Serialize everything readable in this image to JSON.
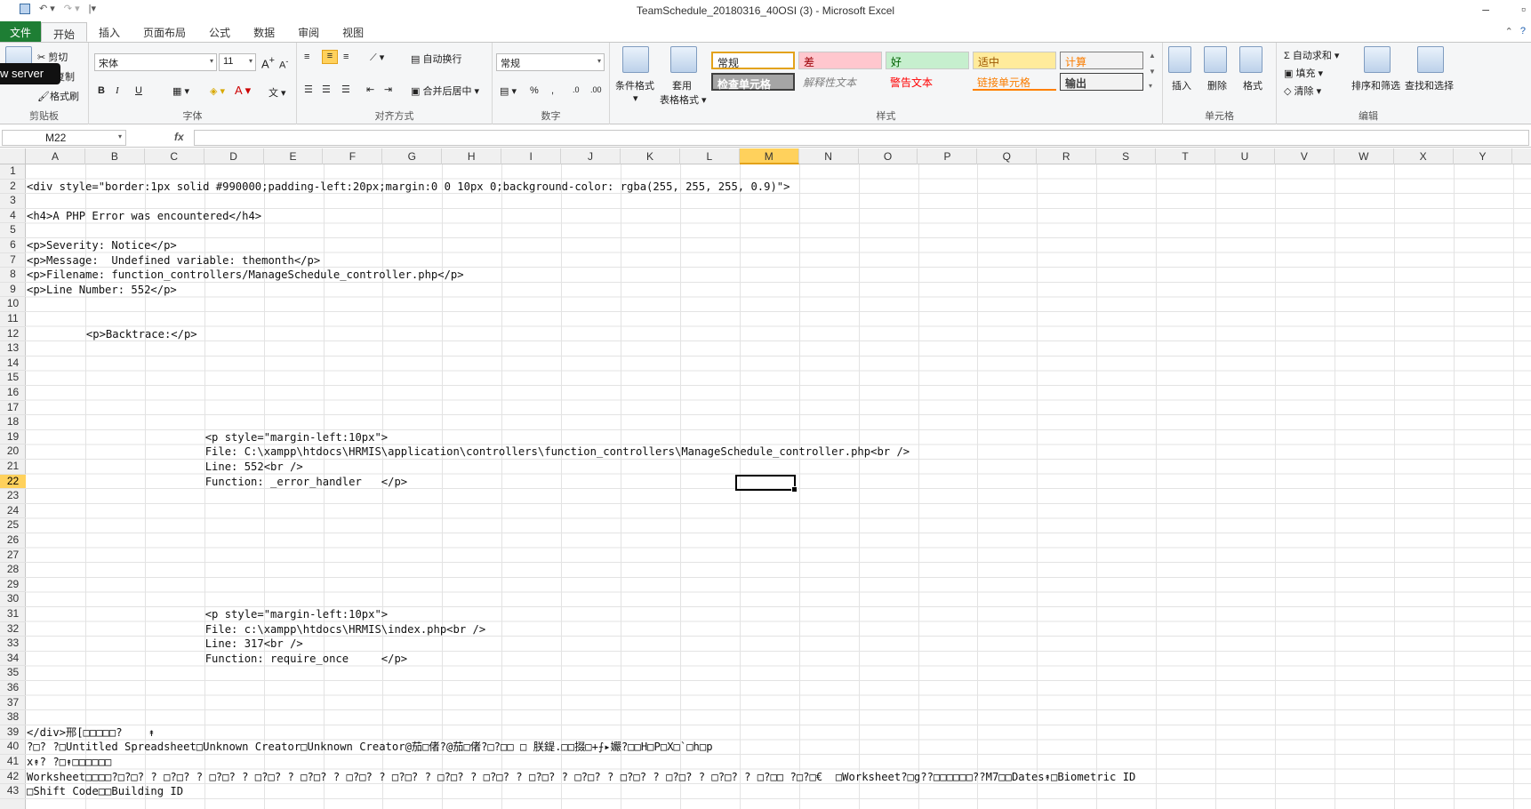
{
  "window": {
    "title": "TeamSchedule_20180316_40OSI (3)  -  Microsoft Excel"
  },
  "tabs": [
    "文件",
    "开始",
    "插入",
    "页面布局",
    "公式",
    "数据",
    "审阅",
    "视图"
  ],
  "tooltip": "w server",
  "ribbon": {
    "clipboard": {
      "cut": "剪切",
      "copy": "复制",
      "format_painter": "格式刷",
      "label": "剪贴板"
    },
    "font": {
      "name": "宋体",
      "size": "11",
      "bold": "B",
      "italic": "I",
      "underline": "U",
      "label": "字体"
    },
    "alignment": {
      "wrap": "自动换行",
      "merge": "合并后居中",
      "label": "对齐方式"
    },
    "number": {
      "format": "常规",
      "label": "数字"
    },
    "styles": {
      "conditional": "条件格式",
      "table_top": "套用",
      "table_bottom": "表格格式",
      "cells": [
        "常规",
        "差",
        "好",
        "适中",
        "计算",
        "检查单元格",
        "解释性文本",
        "警告文本",
        "链接单元格",
        "输出"
      ],
      "label": "样式"
    },
    "cells": {
      "insert": "插入",
      "delete": "删除",
      "format": "格式",
      "label": "单元格"
    },
    "editing": {
      "autosum": "Σ 自动求和",
      "fill": "填充",
      "clear": "清除",
      "sort": "排序和筛选",
      "find": "查找和选择",
      "label": "编辑"
    }
  },
  "formula_bar": {
    "name_box": "M22",
    "fx": "fx",
    "value": ""
  },
  "columns": [
    "A",
    "B",
    "C",
    "D",
    "E",
    "F",
    "G",
    "H",
    "I",
    "J",
    "K",
    "L",
    "M",
    "N",
    "O",
    "P",
    "Q",
    "R",
    "S",
    "T",
    "U",
    "V",
    "W",
    "X",
    "Y"
  ],
  "selected_column": "M",
  "rows": [
    "1",
    "2",
    "3",
    "4",
    "5",
    "6",
    "7",
    "8",
    "9",
    "10",
    "11",
    "12",
    "13",
    "14",
    "15",
    "16",
    "17",
    "18",
    "19",
    "20",
    "21",
    "22",
    "23",
    "24",
    "25",
    "26",
    "27",
    "28",
    "29",
    "30",
    "31",
    "32",
    "33",
    "34",
    "35",
    "36",
    "37",
    "38",
    "39",
    "40",
    "41",
    "42",
    "43"
  ],
  "selected_row": "22",
  "cells": [
    {
      "row": 2,
      "col": "A",
      "text": "<div style=\"border:1px solid #990000;padding-left:20px;margin:0 0 10px 0;background-color: rgba(255, 255, 255, 0.9)\">"
    },
    {
      "row": 4,
      "col": "A",
      "text": "<h4>A PHP Error was encountered</h4>"
    },
    {
      "row": 6,
      "col": "A",
      "text": "<p>Severity: Notice</p>"
    },
    {
      "row": 7,
      "col": "A",
      "text": "<p>Message:  Undefined variable: themonth</p>"
    },
    {
      "row": 8,
      "col": "A",
      "text": "<p>Filename: function_controllers/ManageSchedule_controller.php</p>"
    },
    {
      "row": 9,
      "col": "A",
      "text": "<p>Line Number: 552</p>"
    },
    {
      "row": 12,
      "col": "B",
      "text": "<p>Backtrace:</p>"
    },
    {
      "row": 19,
      "col": "D",
      "text": "<p style=\"margin-left:10px\">"
    },
    {
      "row": 20,
      "col": "D",
      "text": "File: C:\\xampp\\htdocs\\HRMIS\\application\\controllers\\function_controllers\\ManageSchedule_controller.php<br />"
    },
    {
      "row": 21,
      "col": "D",
      "text": "Line: 552<br />"
    },
    {
      "row": 22,
      "col": "D",
      "text": "Function: _error_handler   </p>"
    },
    {
      "row": 31,
      "col": "D",
      "text": "<p style=\"margin-left:10px\">"
    },
    {
      "row": 32,
      "col": "D",
      "text": "File: c:\\xampp\\htdocs\\HRMIS\\index.php<br />"
    },
    {
      "row": 33,
      "col": "D",
      "text": "Line: 317<br />"
    },
    {
      "row": 34,
      "col": "D",
      "text": "Function: require_once     </p>"
    },
    {
      "row": 39,
      "col": "A",
      "text": "</div>邢[□□□□□?    ↟"
    },
    {
      "row": 40,
      "col": "A",
      "text": "?□? ?□Untitled Spreadsheet□Unknown Creator□Unknown Creator@茄□偖?@茄□偖?□?□□ □ 朕鍉.□□掇□+⨍▸孍?□□H□P□X□`□h□p"
    },
    {
      "row": 41,
      "col": "A",
      "text": "x↟? ?□↟□□□□□□"
    },
    {
      "row": 42,
      "col": "A",
      "text": "Worksheet□□□□?□?□? ? □?□? ? □?□? ? □?□? ? □?□? ? □?□? ? □?□? ? □?□? ? □?□? ? □?□? ? □?□? ? □?□? ? □?□? ? □?□? ? □?□□ ?□?□€  □Worksheet?□g??□□□□□□??M7□□Dates↟□Biometric ID"
    },
    {
      "row": 43,
      "col": "A",
      "text": "□Shift Code□□Building ID"
    }
  ]
}
